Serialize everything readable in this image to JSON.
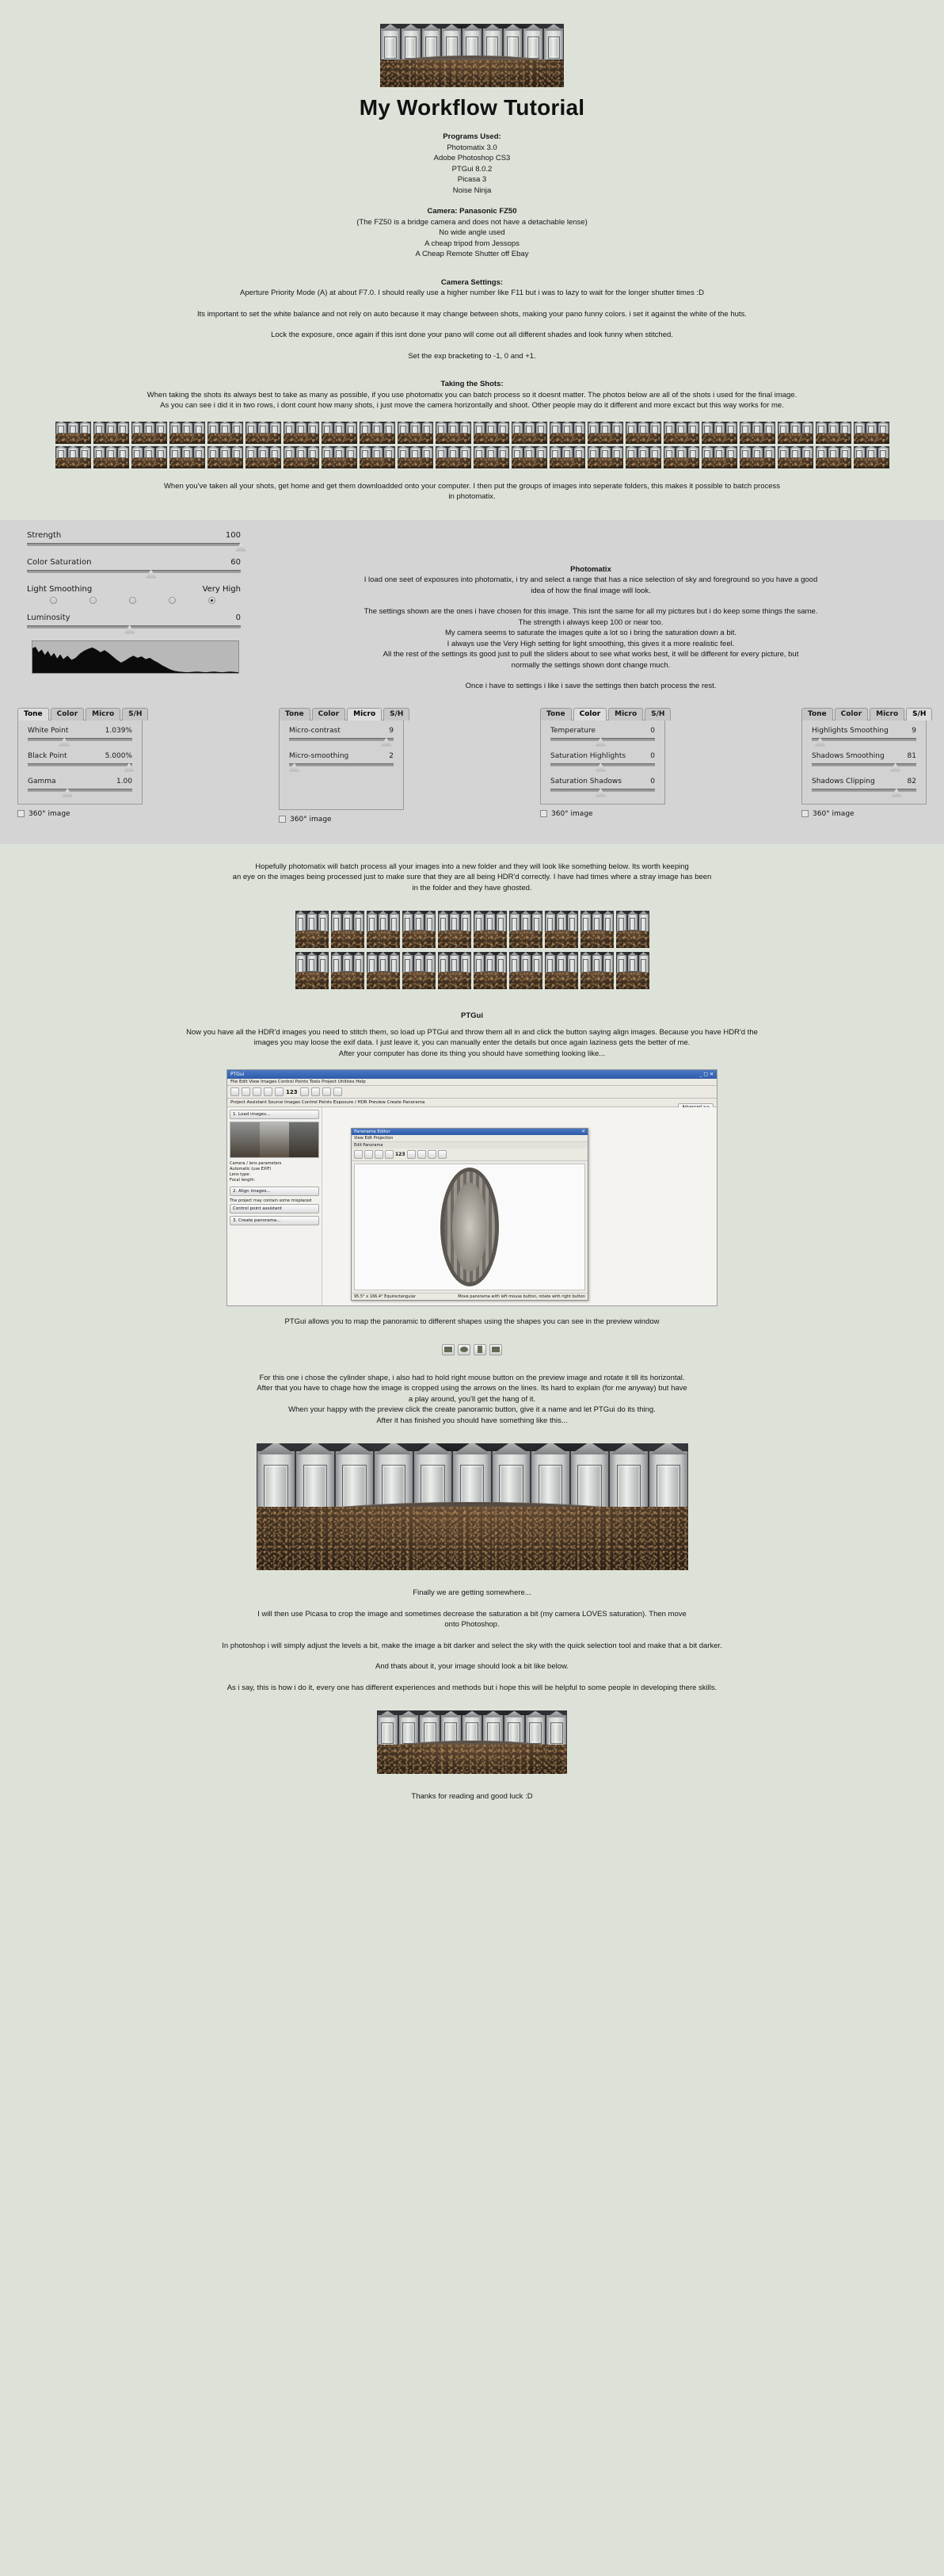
{
  "page": {
    "background": "#dde2d9",
    "title": "My Workflow Tutorial"
  },
  "programs": {
    "heading": "Programs Used:",
    "items": [
      "Photomatix 3.0",
      "Adobe Photoshop CS3",
      "PTGui 8.0.2",
      "Picasa 3",
      "Noise Ninja"
    ]
  },
  "camera": {
    "heading": "Camera: Panasonic FZ50",
    "lines": [
      "(The FZ50 is a bridge camera and does not have a detachable lense)",
      "No wide angle used",
      "A cheap tripod from Jessops",
      "A Cheap Remote Shutter off Ebay"
    ]
  },
  "camera_settings": {
    "heading": "Camera Settings:",
    "line1": "Aperture Priority Mode (A) at about F7.0. I should really use a higher number like F11 but i was to lazy to wait for the longer shutter times :D",
    "line2": "Its important to set the white balance and not rely on auto because it may change between shots, making your pano funny colors. i set it against the white of the huts.",
    "line3": "Lock the exposure, once again if this isnt done your pano will come out all different shades and look funny when stitched.",
    "line4": "Set the exp bracketing to -1, 0 and +1."
  },
  "taking_shots": {
    "heading": "Taking the Shots:",
    "line1": "When taking the shots its always best to take as many as possible, if you use photomatix you can batch process so it doesnt matter. The photos below are all of the shots i used for the final image.",
    "line2": "As you can see i did it in two rows, i dont count how many shots, i just move the camera horizontally and shoot. Other people may do it different and more excact but this way works for me.",
    "after1": "When you've taken all your shots, get home and get them downloadded onto your computer. I then put the groups of images into seperate folders, this makes it possible to batch process",
    "after2": "in photomatix."
  },
  "photomatix": {
    "heading": "Photomatix",
    "p1a": "I load one seet of exposures into photomatix, i try and select a range that has a nice selection of sky and foreground so you have a good",
    "p1b": "idea of how the final image will look.",
    "p2a": "The settings shown are the ones i have chosen for this image. This isnt the same for all my pictures but i do keep some things the same.",
    "p2b": "The strength i always keep 100 or near too.",
    "p2c": "My camera seems to saturate the images quite a lot so i bring the saturation down a bit.",
    "p2d": "I always use the Very High setting for light smoothing, this gives it a more realistic feel.",
    "p2e": "All the rest of the settings its good just to pull the sliders about to see what works best, it will be different for every picture, but",
    "p2f": "normally the settings shown dont change much.",
    "p3": "Once i have to settings i like i save the settings then batch process the rest.",
    "sliders": [
      {
        "label": "Strength",
        "value": "100",
        "pos": 100
      },
      {
        "label": "Color Saturation",
        "value": "60",
        "pos": 58
      }
    ],
    "light_smoothing": {
      "label": "Light Smoothing",
      "value_label": "Very High",
      "options": 5,
      "selected": 5
    },
    "luminosity": {
      "label": "Luminosity",
      "value": "0",
      "pos": 48
    },
    "tabs": [
      "Tone",
      "Color",
      "Micro",
      "S/H"
    ],
    "checkbox_label": "360° image",
    "panels": [
      {
        "active_tab": "Tone",
        "rows": [
          {
            "label": "White Point",
            "value": "1.039%",
            "pos": 35
          },
          {
            "label": "Black Point",
            "value": "5.000%",
            "pos": 97
          },
          {
            "label": "Gamma",
            "value": "1.00",
            "pos": 38
          }
        ]
      },
      {
        "active_tab": "Micro",
        "rows": [
          {
            "label": "Micro-contrast",
            "value": "9",
            "pos": 93
          },
          {
            "label": "Micro-smoothing",
            "value": "2",
            "pos": 5
          }
        ]
      },
      {
        "active_tab": "Color",
        "rows": [
          {
            "label": "Temperature",
            "value": "0",
            "pos": 48
          },
          {
            "label": "Saturation Highlights",
            "value": "0",
            "pos": 48
          },
          {
            "label": "Saturation Shadows",
            "value": "0",
            "pos": 48
          }
        ]
      },
      {
        "active_tab": "S/H",
        "rows": [
          {
            "label": "Highlights Smoothing",
            "value": "9",
            "pos": 8
          },
          {
            "label": "Shadows Smoothing",
            "value": "81",
            "pos": 80
          },
          {
            "label": "Shadows Clipping",
            "value": "82",
            "pos": 81
          }
        ]
      }
    ]
  },
  "batch": {
    "l1": "Hopefully photomatix will batch process all your images into a new folder and they will look like something below. Its worth keeping",
    "l2": "an eye on the images being processed just to make sure that they are all being HDR'd correctly. I have had times where a stray image has been",
    "l3": "in the folder and they have ghosted."
  },
  "ptgui": {
    "heading": "PTGui",
    "l1": "Now you have all the HDR'd images you need to stitch them, so load up PTGui and throw them all in and click the button saying align images. Because you have HDR'd the",
    "l2": "images you may loose the exif data. I just leave it, you can manually enter the details but once again laziness gets the better of me.",
    "l3": "After your computer has done its thing you should have something looking like...",
    "caption": "PTGui allows you to map the panoramic to different shapes using the shapes you can see in the preview window",
    "after1": "For this one i chose the cylinder shape, i also had to hold right mouse button on the preview image and rotate it till its horizontal.",
    "after2": "After that you have to chage how the image is cropped using the arrows on the lines. Its hard to explain (for me anyway) but have",
    "after3": "a play around, you'll get the hang of it.",
    "after4": "When your happy with the preview click the create panoramic button, give it a name and let PTGui do its thing.",
    "after5": "After it has finished you should have something like this...",
    "window": {
      "title": "PTGui",
      "menu": "File  Edit  View  Images  Control Points  Tools  Project  Utilities  Help",
      "numbers": "123",
      "tabs": "Project Assistant   Source Images   Control Points   Exposure / HDR   Preview   Create Panorama",
      "advanced": "Advanced >>",
      "steps": [
        "1. Load images...",
        "2. Align images...",
        "3. Create panorama..."
      ],
      "sidetext": [
        "Camera / lens parameters",
        "Automatic (use EXIF)",
        "Lens type:",
        "Focal length:",
        "The project may contain some misplaced",
        "Control point assistant"
      ],
      "dialog_title": "Panorama Editor",
      "dialog_menu": "View  Edit  Projection",
      "dialog_sub": "Edit Panorama",
      "dialog_numbers": "123",
      "status_left": "95.5° x 166.4° Equirectangular",
      "status_right": "Move panorama with left mouse button, rotate with right button"
    }
  },
  "final": {
    "l1": "Finally we are getting somewhere...",
    "l2a": "I will then use Picasa to crop the image and sometimes decrease the saturation a bit (my camera LOVES saturation). Then move",
    "l2b": "onto Photoshop.",
    "l3": "In photoshop i will simply adjust the levels a bit, make the image a bit darker and select the sky with the quick selection tool and make that a bit darker.",
    "l4": "And thats about it, your image should look a bit like below.",
    "l5": "As i say, this is how i do it, every one has different experiences and methods but i hope this will be helpful to some people in developing there skills.",
    "thanks": "Thanks for reading and good luck :D"
  },
  "shot_strip_rows": 2,
  "shot_strip_count": 22,
  "hdr_rows": 2,
  "hdr_count": 10
}
